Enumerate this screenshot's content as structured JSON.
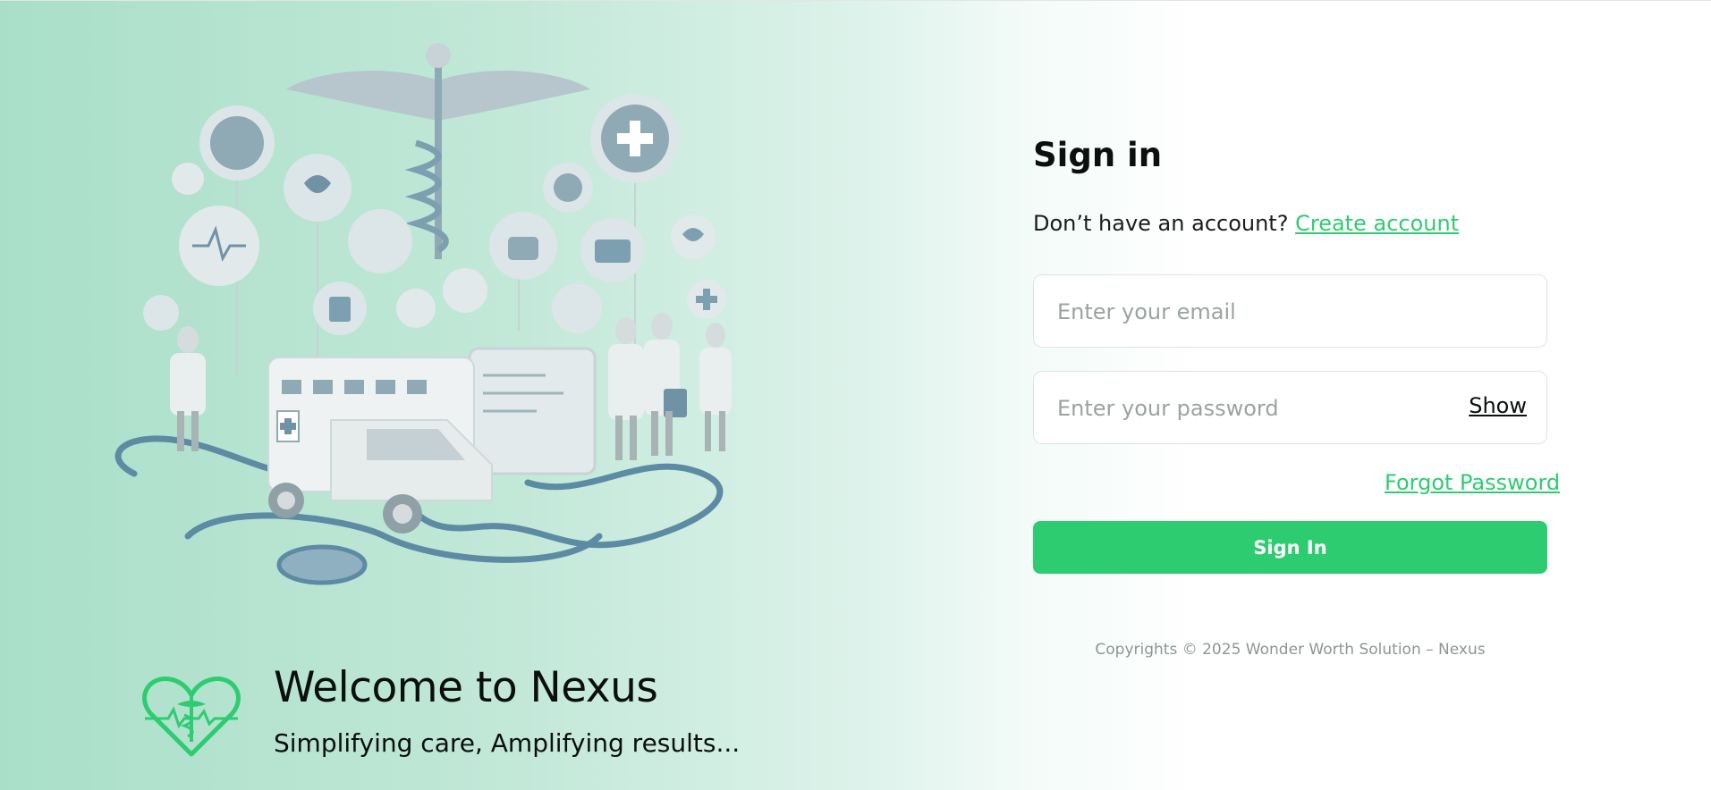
{
  "brand": {
    "welcome_title": "Welcome to Nexus",
    "tagline": "Simplifying care, Amplifying results...",
    "logo_icon": "heart-caduceus-icon"
  },
  "illustration": {
    "icon": "healthcare-illustration"
  },
  "signin": {
    "title": "Sign in",
    "no_account_text": "Don’t have an account?",
    "create_account_label": "Create account",
    "email_placeholder": "Enter your email",
    "password_placeholder": "Enter your password",
    "show_label": "Show",
    "forgot_password_label": "Forgot Password",
    "submit_label": "Sign In"
  },
  "footer": {
    "copyright": "Copyrights © 2025 Wonder Worth Solution – Nexus"
  },
  "colors": {
    "accent": "#2ecc71",
    "illustration_blue": "#5c8ba3",
    "background_mint": "#a9dfc9"
  }
}
